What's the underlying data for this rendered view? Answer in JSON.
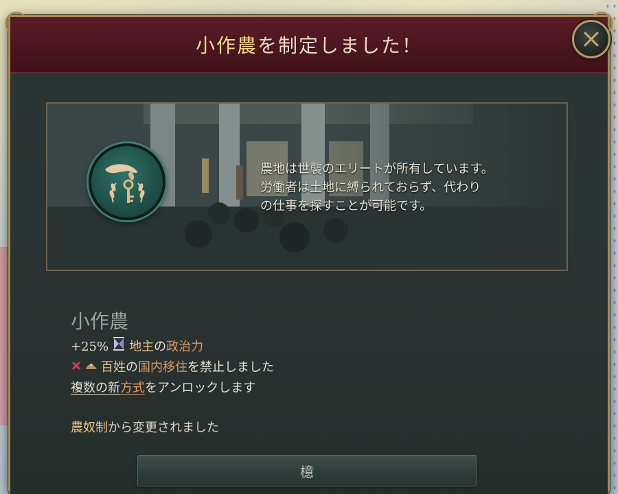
{
  "dialog": {
    "title_highlight": "小作農",
    "title_rest": "を制定しました！",
    "close_icon": "close-x-icon"
  },
  "illustration": {
    "badge_icon": "hand-key-wheat-icon",
    "description": "農地は世襲のエリートが所有しています。\n労働者は土地に縛られておらず、代わり\nの仕事を探すことが可能です。"
  },
  "law": {
    "name": "小作農",
    "effects": [
      {
        "prefix": "+25%",
        "icon": "landowners-icon",
        "text_a": "地主",
        "text_b": "の",
        "text_c": "政治力"
      },
      {
        "icon_a": "cross-icon",
        "icon_b": "peasants-icon",
        "text_a": "百姓",
        "text_b": "の",
        "text_c": "国内移住",
        "text_d": "を禁止しました"
      },
      {
        "text_a": "複数の新",
        "text_b": "方式",
        "text_c": "をアンロックします"
      }
    ],
    "changed_from_a": "農奴制",
    "changed_from_b": "から変更されました"
  },
  "button": {
    "ok_label": "檍"
  },
  "colors": {
    "header": "#4c1620",
    "gold": "#e8c48a",
    "orange": "#e3986a",
    "badge": "#2f7267"
  }
}
